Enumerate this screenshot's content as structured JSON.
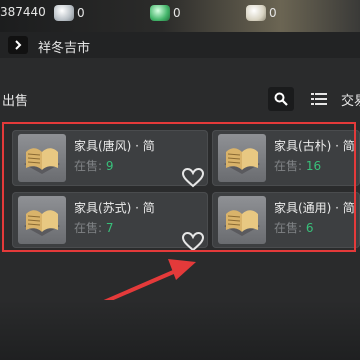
{
  "resources": [
    {
      "icon": "silver-coin-icon",
      "value": "387440"
    },
    {
      "icon": "silver-ingot-icon",
      "value": "0"
    },
    {
      "icon": "jade-coin-icon",
      "value": "0"
    },
    {
      "icon": "gold-ingot-icon",
      "value": "0"
    }
  ],
  "market": {
    "name": "祥冬吉市"
  },
  "section": {
    "sell_label": "出售",
    "trade_label": "交易"
  },
  "items": [
    {
      "name": "家具(唐风) · 简",
      "stock_label": "在售:",
      "count": "9",
      "icon": "furniture-book-icon"
    },
    {
      "name": "家具(古朴) · 简",
      "stock_label": "在售:",
      "count": "16",
      "icon": "furniture-book-icon"
    },
    {
      "name": "家具(苏式) · 简",
      "stock_label": "在售:",
      "count": "7",
      "icon": "furniture-book-icon"
    },
    {
      "name": "家具(通用) · 简",
      "stock_label": "在售:",
      "count": "6",
      "icon": "furniture-book-icon"
    }
  ],
  "colors": {
    "highlight": "#e43a3a",
    "count_green": "#38c07a"
  }
}
